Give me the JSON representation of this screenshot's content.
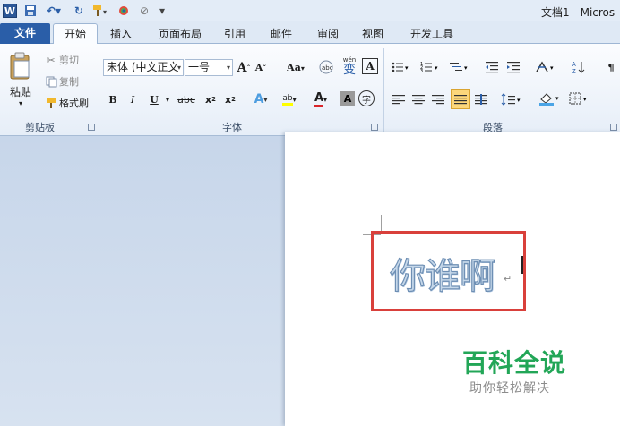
{
  "window": {
    "title": "文档1 - Micros"
  },
  "quick_access": {
    "word_logo": "W",
    "save_icon": "save-icon",
    "undo_icon": "undo-icon",
    "redo_icon": "redo-icon",
    "customize": "▾"
  },
  "tabs": [
    "文件",
    "开始",
    "插入",
    "页面布局",
    "引用",
    "邮件",
    "审阅",
    "视图",
    "开发工具"
  ],
  "clipboard": {
    "paste": "粘贴",
    "cut": "剪切",
    "copy": "复制",
    "format_painter": "格式刷",
    "label": "剪贴板"
  },
  "font": {
    "family": "宋体 (中文正文",
    "size": "一号",
    "grow": "A",
    "shrink": "A",
    "change_case": "Aa",
    "phonetic": "wén",
    "phonetic_char": "变",
    "border_char": "A",
    "bold": "B",
    "italic": "I",
    "underline": "U",
    "strike": "abc",
    "subscript": "x",
    "superscript": "x",
    "text_effect": "A",
    "highlight": "ab",
    "font_color": "A",
    "char_shading": "A",
    "enclose": "字",
    "label": "字体"
  },
  "paragraph": {
    "label": "段落"
  },
  "document": {
    "text": "你谁啊",
    "para_mark": "↵"
  },
  "watermark": {
    "title": "百科全说",
    "subtitle": "助你轻松解决"
  },
  "colors": {
    "file_tab": "#2a5ea8",
    "highlight_box": "#d9403b",
    "watermark_green": "#22a657"
  }
}
